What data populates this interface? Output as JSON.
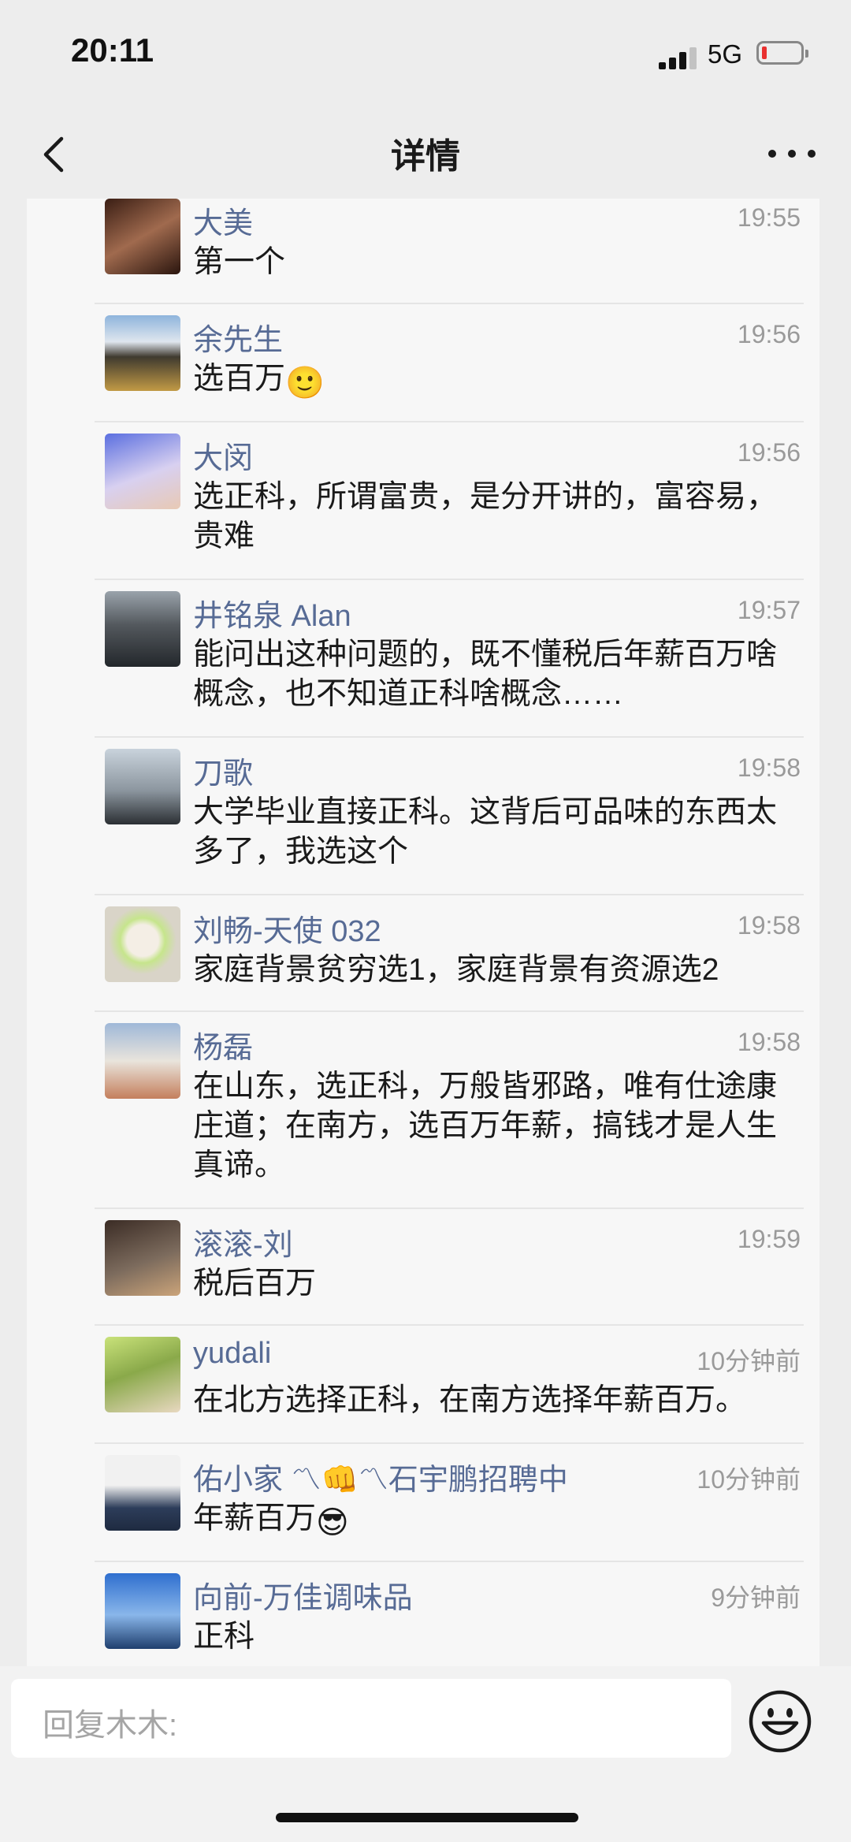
{
  "status_bar": {
    "time": "20:11",
    "network": "5G"
  },
  "header": {
    "title": "详情"
  },
  "comments": [
    {
      "name": "大美",
      "time": "19:55",
      "text": "第一个"
    },
    {
      "name": "余先生",
      "time": "19:56",
      "text": "选百万",
      "emoji": "🙂"
    },
    {
      "name": "大闵",
      "time": "19:56",
      "text": "选正科，所谓富贵，是分开讲的，富容易，贵难"
    },
    {
      "name": "井铭泉 Alan",
      "time": "19:57",
      "text": "能问出这种问题的，既不懂税后年薪百万啥概念，也不知道正科啥概念……"
    },
    {
      "name": "刀歌",
      "time": "19:58",
      "text": "大学毕业直接正科。这背后可品味的东西太多了，我选这个"
    },
    {
      "name": "刘畅-天使 032",
      "time": "19:58",
      "text": "家庭背景贫穷选1，家庭背景有资源选2"
    },
    {
      "name": "杨磊",
      "time": "19:58",
      "text": "在山东，选正科，万般皆邪路，唯有仕途康庄道；在南方，选百万年薪，搞钱才是人生真谛。"
    },
    {
      "name": "滚滚-刘",
      "time": "19:59",
      "text": "税后百万"
    },
    {
      "name": "yudali",
      "time": "10分钟前",
      "text": "在北方选择正科，在南方选择年薪百万。"
    },
    {
      "name": "佑小家 〽👊〽石宇鹏招聘中",
      "time": "10分钟前",
      "text": "年薪百万",
      "emoji": "😎"
    },
    {
      "name": "向前-万佳调味品",
      "time": "9分钟前",
      "text": "正科"
    }
  ],
  "reply": {
    "placeholder": "回复木木:"
  }
}
